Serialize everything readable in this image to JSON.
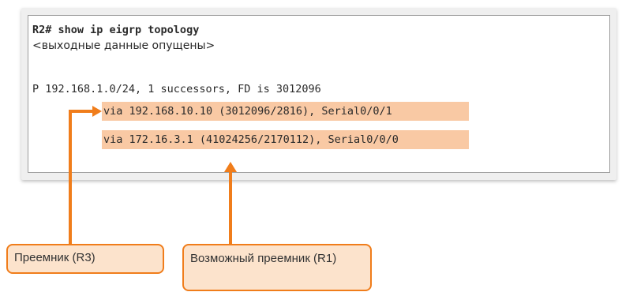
{
  "terminal": {
    "command": "R2# show ip eigrp topology",
    "omitted_note": "<выходные данные опущены>",
    "route_line": "P 192.168.1.0/24, 1 successors, FD is 3012096",
    "successor_line": "via 192.168.10.10 (3012096/2816), Serial0/0/1",
    "feasible_successor_line": "via 172.16.3.1 (41024256/2170112), Serial0/0/0"
  },
  "callouts": {
    "successor": "Преемник (R3)",
    "feasible_successor": "Возможный преемник (R1)"
  },
  "colors": {
    "highlight": "#f9c9a4",
    "accent": "#f07d1b",
    "callout_fill": "#fce3cc"
  }
}
